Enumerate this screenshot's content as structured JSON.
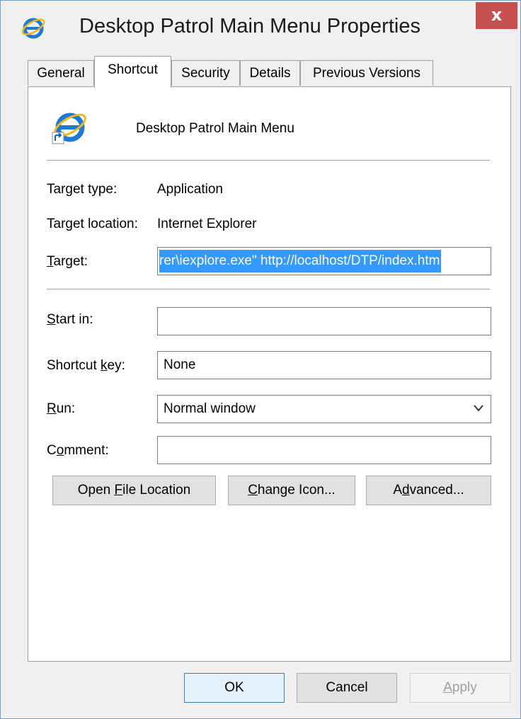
{
  "window": {
    "title": "Desktop Patrol Main Menu Properties",
    "close_glyph": "x"
  },
  "tabs": [
    {
      "label": "General"
    },
    {
      "label": "Shortcut"
    },
    {
      "label": "Security"
    },
    {
      "label": "Details"
    },
    {
      "label": "Previous Versions"
    }
  ],
  "header": {
    "name": "Desktop Patrol Main Menu",
    "icon": "internet-explorer-shortcut-icon"
  },
  "fields": {
    "target_type": {
      "label": "Target type:",
      "value": "Application"
    },
    "target_location": {
      "label": "Target location:",
      "value": "Internet Explorer"
    },
    "target": {
      "label": "Target:",
      "value": "rer\\iexplore.exe\" http://localhost/DTP/index.htm"
    },
    "start_in": {
      "label": "Start in:",
      "value": ""
    },
    "shortcut_key": {
      "label": "Shortcut key:",
      "value": "None"
    },
    "run": {
      "label": "Run:",
      "value": "Normal window"
    },
    "comment": {
      "label": "Comment:",
      "value": ""
    }
  },
  "buttons": {
    "open_file_location": "Open File Location",
    "change_icon": "Change Icon...",
    "advanced": "Advanced...",
    "ok": "OK",
    "cancel": "Cancel",
    "apply": "Apply"
  },
  "colors": {
    "selection": "#3399ff",
    "close": "#c75050"
  }
}
